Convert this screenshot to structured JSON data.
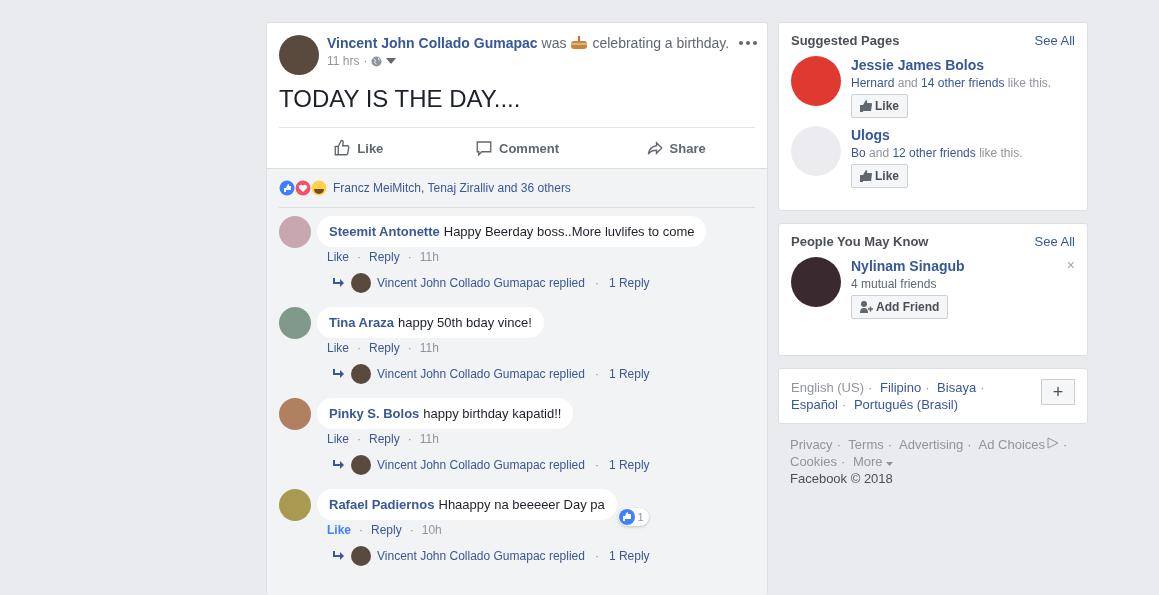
{
  "post": {
    "author": "Vincent John Collado Gumapac",
    "activity_verb": "was",
    "activity": "celebrating a birthday.",
    "time": "11 hrs",
    "separator": "·",
    "text": "TODAY IS THE DAY....",
    "actions": [
      "Like",
      "Comment",
      "Share"
    ],
    "reactions_summary": "Francz MeiMitch, Tenaj Ziralliv and 36 others"
  },
  "comments": [
    {
      "name": "Steemit Antonette",
      "text": "Happy Beerday boss..More luvlifes to come",
      "like": "Like",
      "reply": "Reply",
      "time": "11h",
      "liked": false,
      "replied": "Vincent John Collado Gumapac replied",
      "replies": "1 Reply"
    },
    {
      "name": "Tina Araza",
      "text": "happy 50th bday vince!",
      "like": "Like",
      "reply": "Reply",
      "time": "11h",
      "liked": false,
      "replied": "Vincent John Collado Gumapac replied",
      "replies": "1 Reply"
    },
    {
      "name": "Pinky S. Bolos",
      "text": "happy birthday kapatid!!",
      "like": "Like",
      "reply": "Reply",
      "time": "11h",
      "liked": false,
      "replied": "Vincent John Collado Gumapac replied",
      "replies": "1 Reply"
    },
    {
      "name": "Rafael Padiernos",
      "text": "Hhaappy na beeeeer Day pa",
      "like": "Like",
      "reply": "Reply",
      "time": "10h",
      "liked": true,
      "reaction_count": "1",
      "replied": "Vincent John Collado Gumapac replied",
      "replies": "1 Reply"
    }
  ],
  "suggested_pages": {
    "title": "Suggested Pages",
    "see_all": "See All",
    "items": [
      {
        "name": "Jessie James Bolos",
        "friend": "Hernard",
        "and": "and",
        "others": "14 other friends",
        "suffix": "like this.",
        "button": "Like"
      },
      {
        "name": "Ulogs",
        "friend": "Bo",
        "and": "and",
        "others": "12 other friends",
        "suffix": "like this.",
        "button": "Like"
      }
    ]
  },
  "people_you_may_know": {
    "title": "People You May Know",
    "see_all": "See All",
    "items": [
      {
        "name": "Nylinam Sinagub",
        "mutual": "4 mutual friends",
        "button": "Add Friend",
        "dismiss": "×"
      }
    ]
  },
  "languages": {
    "items": [
      {
        "label": "English (US)",
        "selected": true
      },
      {
        "label": "Filipino",
        "selected": false
      },
      {
        "label": "Bisaya",
        "selected": false
      },
      {
        "label": "Español",
        "selected": false
      },
      {
        "label": "Português (Brasil)",
        "selected": false
      }
    ],
    "add": "+"
  },
  "separator": "·",
  "footer": {
    "links": [
      "Privacy",
      "Terms",
      "Advertising",
      "Ad Choices",
      "Cookies",
      "More"
    ],
    "copyright": "Facebook © 2018"
  }
}
